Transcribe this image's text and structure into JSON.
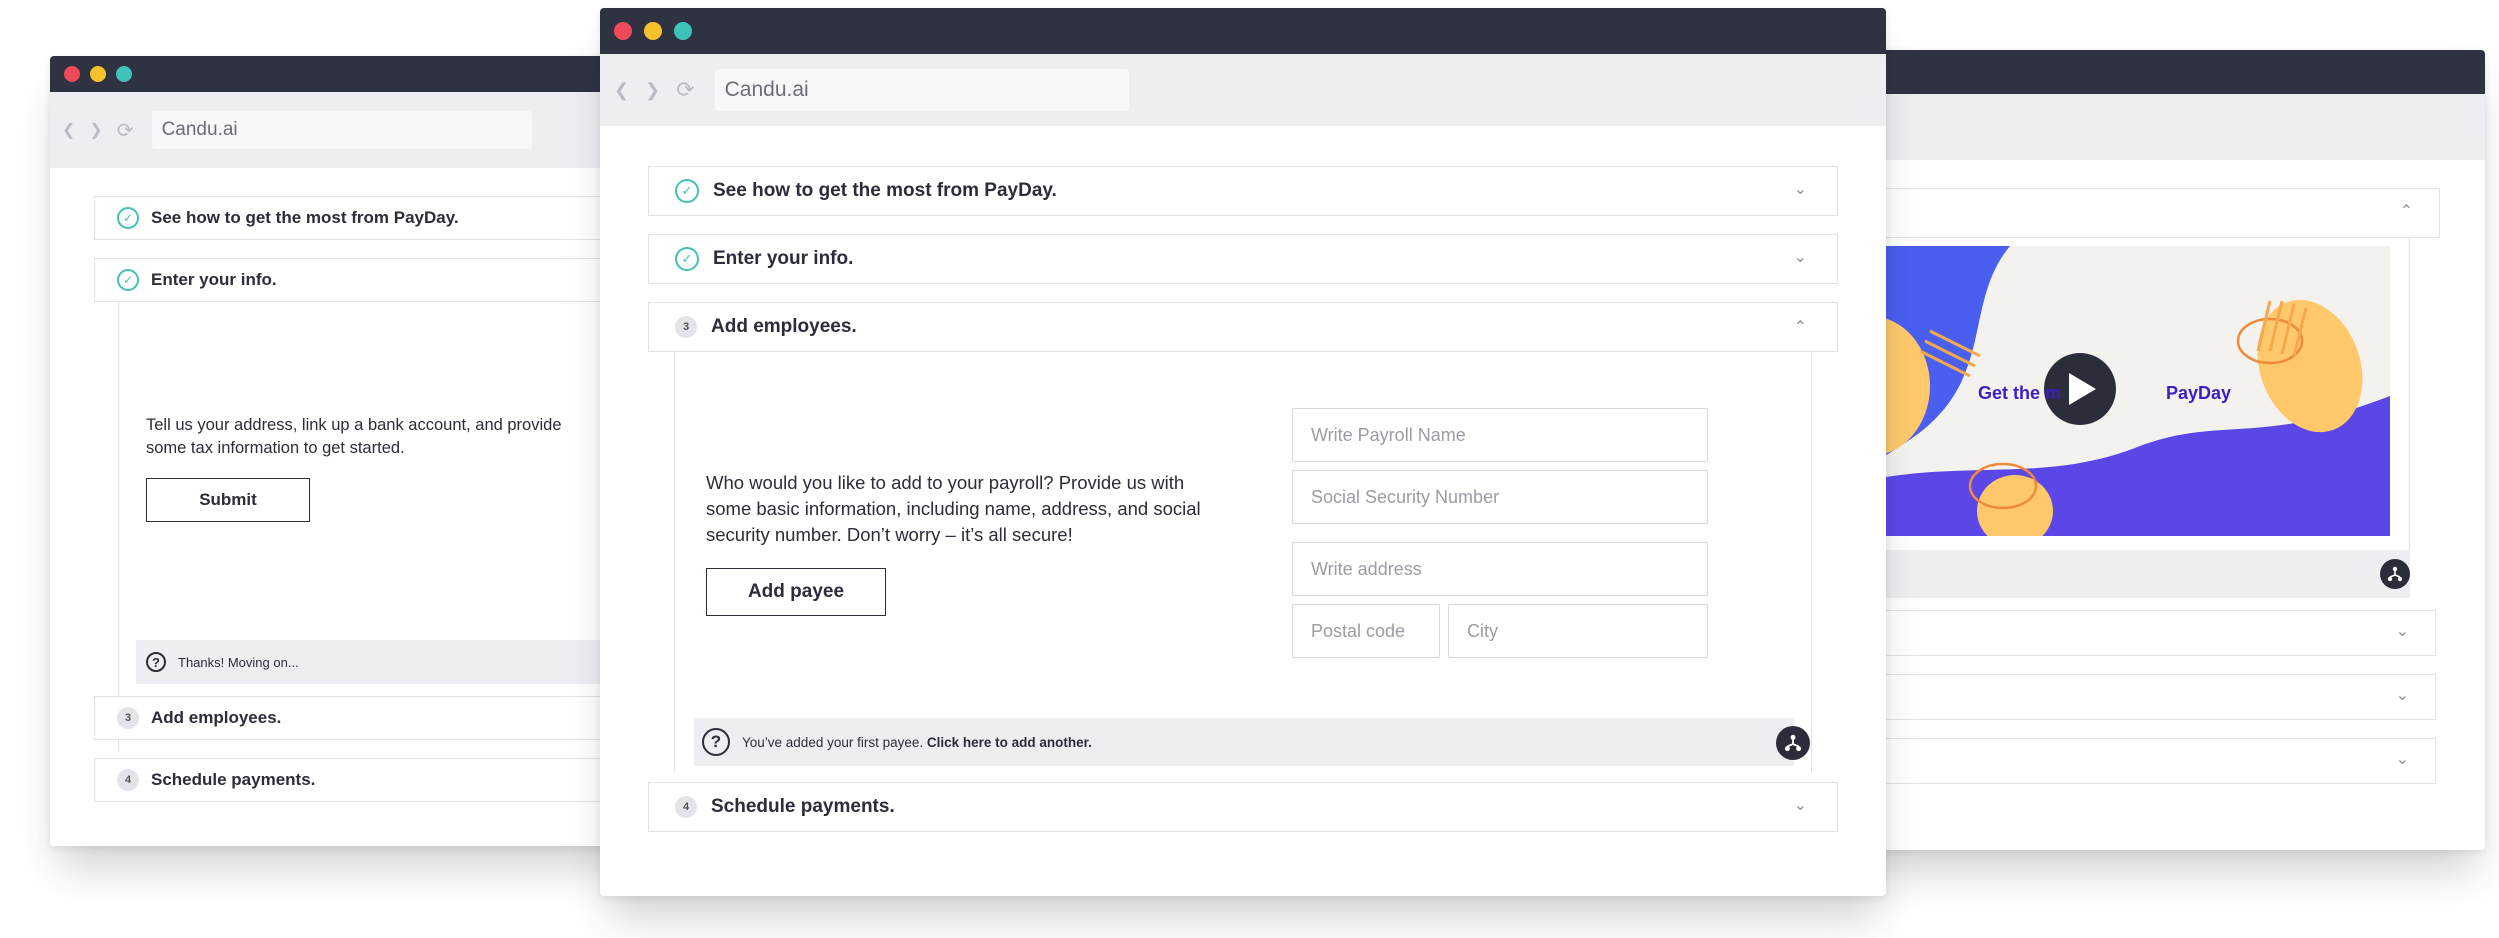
{
  "browser": {
    "url_text": "Candu.ai"
  },
  "left_window": {
    "steps": [
      {
        "label": "See how to get the most from PayDay.",
        "status": "done"
      },
      {
        "label": "Enter your info.",
        "status": "done"
      },
      {
        "label": "Add employees.",
        "number": "3"
      },
      {
        "label": "Schedule payments.",
        "number": "4"
      }
    ],
    "body_text": "Tell us your address, link up a bank account, and provide some tax information to get started.",
    "submit_label": "Submit",
    "hint_text": "Thanks! Moving on..."
  },
  "center_window": {
    "steps": [
      {
        "label": "See how to get the most from PayDay.",
        "status": "done"
      },
      {
        "label": "Enter your info.",
        "status": "done"
      },
      {
        "label": "Add employees.",
        "number": "3",
        "expanded": true
      },
      {
        "label": "Schedule payments.",
        "number": "4"
      }
    ],
    "body_text": "Who would you like to add to your payroll? Provide us with some basic information, including name, address, and social security number. Don’t worry – it’s all secure!",
    "add_payee_label": "Add payee",
    "fields": {
      "payroll_name_placeholder": "Write Payroll Name",
      "ssn_placeholder": "Social Security Number",
      "address_placeholder": "Write address",
      "postal_placeholder": "Postal code",
      "city_placeholder": "City"
    },
    "hint_text": "You’ve added your first payee. ",
    "hint_link": "Click here to add another."
  },
  "right_window": {
    "video_caption_left": "Get the m",
    "video_caption_right": "PayDay"
  },
  "colors": {
    "titlebar": "#2f3240",
    "accent_teal": "#3fc2b8",
    "video_blue": "#4a5ef0",
    "video_orange": "#f6a84c"
  },
  "icons": [
    "check-icon",
    "chevron-down-icon",
    "chevron-up-icon",
    "question-icon",
    "share-icon",
    "play-icon",
    "back-icon",
    "forward-icon",
    "reload-icon"
  ]
}
